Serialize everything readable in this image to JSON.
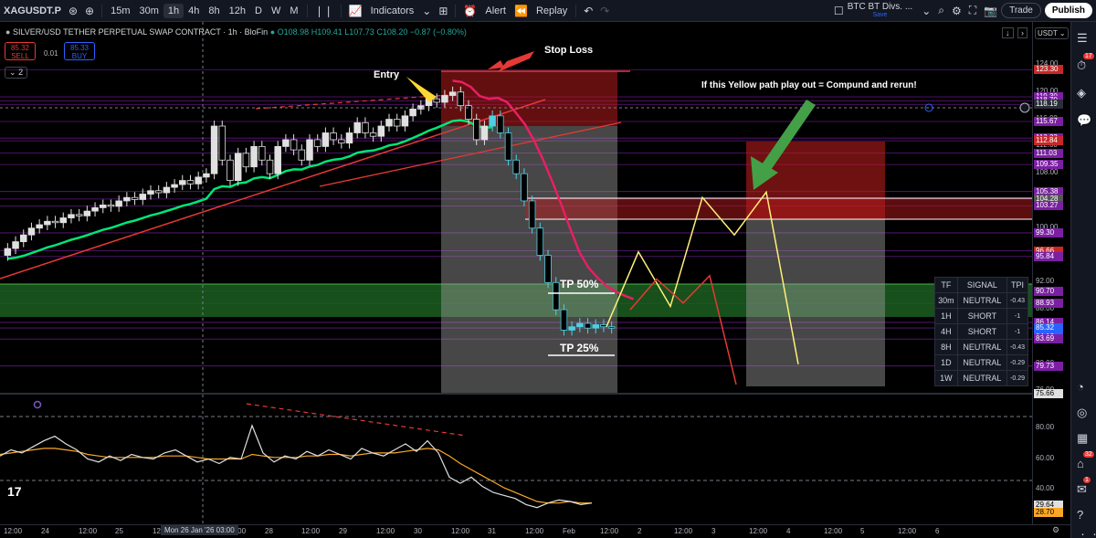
{
  "toolbar": {
    "symbol": "XAGUSDT.P",
    "intervals": [
      "15m",
      "30m",
      "1h",
      "4h",
      "8h",
      "12h",
      "D",
      "W",
      "M"
    ],
    "active_interval": "1h",
    "indicators_label": "Indicators",
    "alert_label": "Alert",
    "replay_label": "Replay",
    "layout_name": "BTC BT Divs. ...",
    "layout_sub": "Save",
    "trade_label": "Trade",
    "publish_label": "Publish"
  },
  "legend": {
    "title": "SILVER/USD TETHER PERPETUAL SWAP CONTRACT · 1h · BloFin",
    "open": "O108.98",
    "high": "H109.41",
    "low": "L107.73",
    "close": "C108.20",
    "change": "−0.87 (−0.80%)",
    "sell_price": "85.32",
    "sell_label": "SELL",
    "spread": "0.01",
    "buy_price": "85.33",
    "buy_label": "BUY",
    "indicator_count": "2"
  },
  "annotations": {
    "entry": "Entry",
    "stop_loss": "Stop Loss",
    "tp50": "TP 50%",
    "tp25": "TP 25%",
    "yellow_path": "If this Yellow path play out = Compund and rerun!"
  },
  "currency": "USDT",
  "price_axis": {
    "ticks": [
      "124.00",
      "120.00",
      "116.00",
      "112.00",
      "108.00",
      "104.00",
      "100.00",
      "96.00",
      "92.00",
      "88.00",
      "84.00",
      "80.00",
      "76.00"
    ],
    "tags": [
      {
        "value": "123.30",
        "color": "#c62828"
      },
      {
        "value": "119.30",
        "color": "#7b1fa2"
      },
      {
        "value": "118.70",
        "color": "#7b1fa2"
      },
      {
        "value": "118.19",
        "color": "#2a2e39"
      },
      {
        "value": "115.67",
        "color": "#7b1fa2"
      },
      {
        "value": "113.23",
        "color": "#7b1fa2"
      },
      {
        "value": "112.84",
        "color": "#c62828"
      },
      {
        "value": "111.03",
        "color": "#7b1fa2"
      },
      {
        "value": "109.35",
        "color": "#7b1fa2"
      },
      {
        "value": "105.38",
        "color": "#7b1fa2"
      },
      {
        "value": "104.28",
        "color": "#555"
      },
      {
        "value": "103.27",
        "color": "#7b1fa2"
      },
      {
        "value": "99.30",
        "color": "#7b1fa2"
      },
      {
        "value": "96.66",
        "color": "#c62828"
      },
      {
        "value": "95.84",
        "color": "#7b1fa2"
      },
      {
        "value": "90.70",
        "color": "#7b1fa2"
      },
      {
        "value": "88.93",
        "color": "#7b1fa2"
      },
      {
        "value": "86.14",
        "color": "#7b1fa2"
      },
      {
        "value": "85.32",
        "color": "#2962ff"
      },
      {
        "value": "04:12",
        "color": "#2962ff"
      },
      {
        "value": "83.69",
        "color": "#7b1fa2"
      },
      {
        "value": "79.73",
        "color": "#7b1fa2"
      },
      {
        "value": "75.66",
        "color": "#e0e0e0"
      }
    ],
    "osc_ticks": [
      "80.00",
      "60.00",
      "40.00"
    ],
    "osc_tags": [
      {
        "value": "29.64",
        "color": "#e0e0e0"
      },
      {
        "value": "28.70",
        "color": "#f9a825"
      }
    ]
  },
  "time_axis": {
    "labels": [
      "12:00",
      "24",
      "12:00",
      "25",
      "12:00",
      "27",
      "12:00",
      "28",
      "12:00",
      "29",
      "12:00",
      "30",
      "12:00",
      "31",
      "12:00",
      "Feb",
      "12:00",
      "2",
      "12:00",
      "3",
      "12:00",
      "4",
      "12:00",
      "5",
      "12:00",
      "6"
    ],
    "cursor_label": "Mon 26 Jan '26   03:00"
  },
  "signal_table": {
    "headers": [
      "TF",
      "SIGNAL",
      "TPI"
    ],
    "rows": [
      {
        "tf": "30m",
        "signal": "NEUTRAL",
        "tpi": "-0.43"
      },
      {
        "tf": "1H",
        "signal": "SHORT",
        "tpi": "-1"
      },
      {
        "tf": "4H",
        "signal": "SHORT",
        "tpi": "-1"
      },
      {
        "tf": "8H",
        "signal": "NEUTRAL",
        "tpi": "-0.43"
      },
      {
        "tf": "1D",
        "signal": "NEUTRAL",
        "tpi": "-0.29"
      },
      {
        "tf": "1W",
        "signal": "NEUTRAL",
        "tpi": "-0.29"
      }
    ]
  },
  "sidebar": {
    "badges": [
      "17",
      "32",
      "1"
    ]
  },
  "colors": {
    "up": "#26a69a",
    "down": "#ef5350",
    "candle": "#e0e0e0",
    "ema_fast": "#e91e63",
    "ema_slow": "#00e676",
    "trend": "#e53935",
    "yellow_path": "#fff176",
    "red_path": "#e53935",
    "arrow_green": "#43a047",
    "arrow_yellow": "#fdd835",
    "arrow_red": "#e53935"
  },
  "chart_data": {
    "type": "candlestick",
    "price_range": [
      75.66,
      124.0
    ],
    "candles_close": [
      97,
      98,
      99,
      100,
      100.5,
      101,
      100.8,
      101.5,
      102,
      101.8,
      102.5,
      103,
      103.4,
      103.2,
      104,
      104.5,
      104.2,
      105,
      105.5,
      105.2,
      106,
      106.4,
      107,
      106.5,
      107.5,
      108,
      115,
      110,
      107,
      111,
      109,
      112,
      110,
      108,
      112,
      113,
      111.5,
      110,
      113,
      112,
      114,
      113,
      112.5,
      114,
      115.5,
      114,
      113.5,
      115,
      116,
      115,
      116.5,
      117.5,
      118,
      119,
      118.5,
      119.5,
      120,
      118,
      116,
      113,
      115,
      116.5,
      114,
      110,
      108,
      104,
      100,
      96,
      92,
      88,
      85,
      85.5,
      86,
      85.3,
      85.8,
      85.5,
      85.3
    ],
    "levels": [
      123.3,
      119.3,
      118.7,
      118.19,
      115.67,
      113.23,
      112.84,
      111.03,
      109.35,
      105.38,
      104.28,
      103.27,
      99.3,
      96.66,
      95.84,
      90.7,
      88.93,
      86.14,
      85.32,
      83.69,
      79.73,
      75.66
    ],
    "yellow_path": [
      [
        0,
        85.5
      ],
      [
        1,
        96.5
      ],
      [
        2,
        88.5
      ],
      [
        3,
        104.5
      ],
      [
        4,
        99
      ],
      [
        5,
        105.3
      ],
      [
        6,
        80
      ]
    ],
    "red_path": [
      [
        0,
        88
      ],
      [
        1,
        92.5
      ],
      [
        2,
        89
      ],
      [
        3,
        93
      ],
      [
        4,
        77
      ]
    ],
    "oscillator_range": [
      20,
      100
    ],
    "oscillator": [
      62,
      66,
      64,
      68,
      72,
      75,
      70,
      66,
      60,
      58,
      62,
      59,
      63,
      61,
      60,
      64,
      66,
      62,
      58,
      60,
      57,
      61,
      60,
      82,
      64,
      58,
      62,
      60,
      65,
      62,
      66,
      63,
      60,
      67,
      64,
      62,
      66,
      70,
      65,
      72,
      64,
      48,
      44,
      48,
      42,
      38,
      36,
      34,
      30,
      28,
      31,
      33,
      32,
      30,
      31
    ],
    "oscillator_ma": [
      63,
      64,
      65,
      66,
      67,
      67,
      66,
      65,
      63,
      62,
      61,
      61,
      61,
      61,
      61,
      62,
      62,
      62,
      61,
      60,
      60,
      60,
      60,
      63,
      62,
      61,
      61,
      61,
      62,
      62,
      63,
      63,
      62,
      63,
      64,
      64,
      64,
      65,
      66,
      67,
      66,
      62,
      57,
      53,
      49,
      45,
      41,
      38,
      35,
      32,
      31,
      31,
      32,
      31,
      31
    ]
  }
}
